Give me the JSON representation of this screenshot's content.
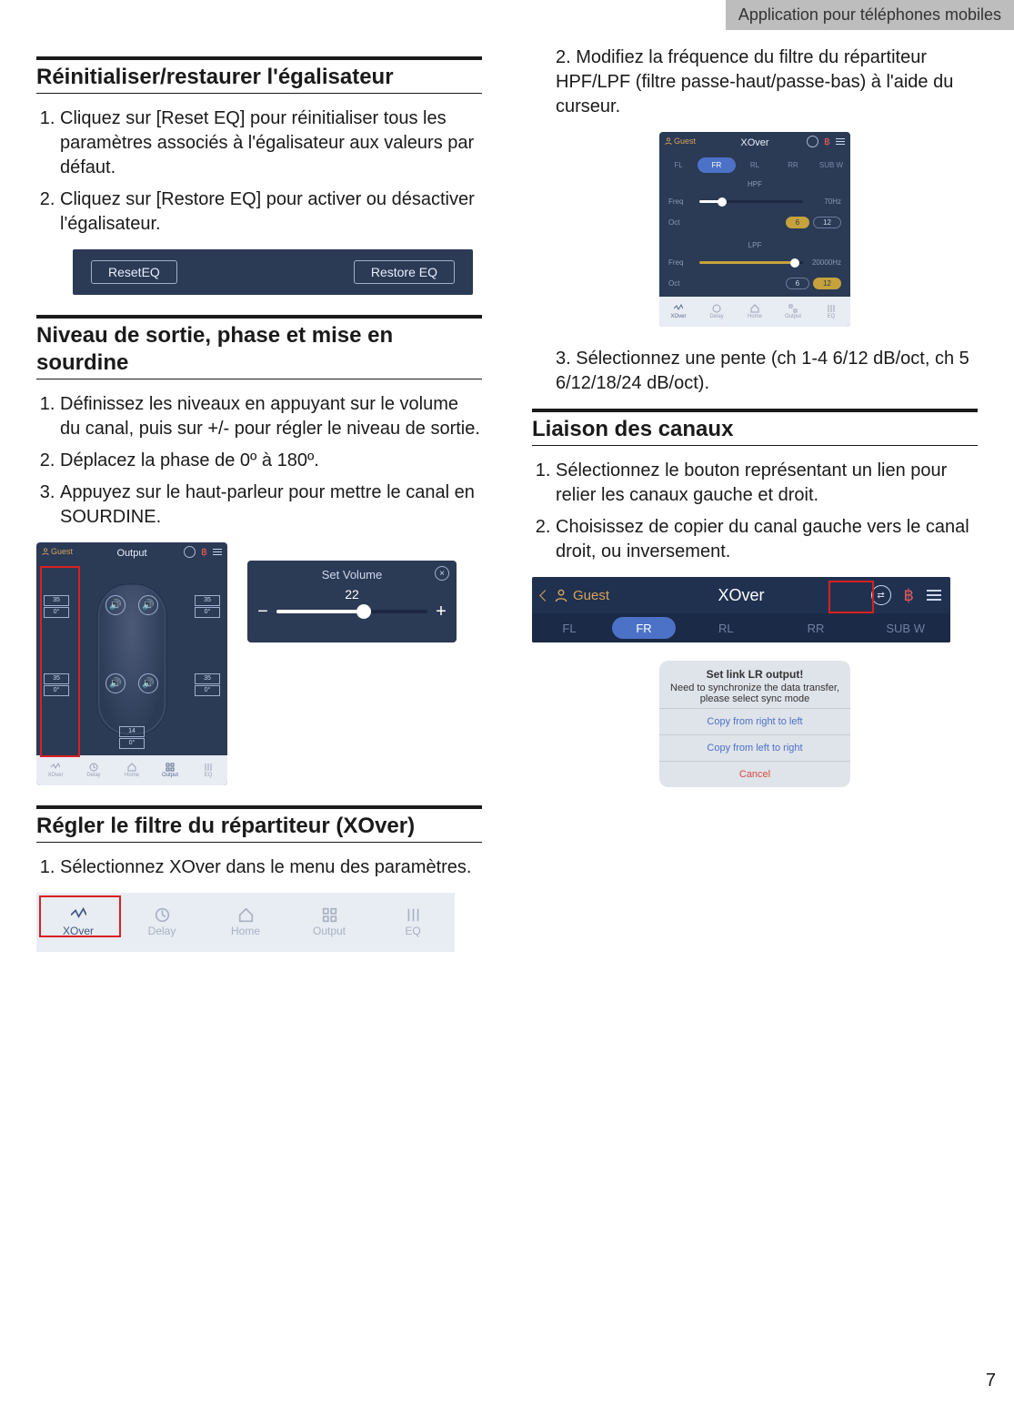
{
  "header_tab": "Application pour téléphones mobiles",
  "page_number": "7",
  "left": {
    "sec1_heading": "Réinitialiser/restaurer l'égalisateur",
    "sec1_li1": "Cliquez sur [Reset EQ] pour réinitialiser tous les paramètres associés à l'égalisateur aux valeurs par défaut.",
    "sec1_li2": "Cliquez sur [Restore EQ] pour activer ou désactiver l'égalisateur.",
    "eq_bar": {
      "reset": "ResetEQ",
      "restore": "Restore EQ"
    },
    "sec2_heading": "Niveau de sortie, phase et mise en sourdine",
    "sec2_li1": "Définissez les niveaux en appuyant sur le volume du canal, puis sur +/- pour régler le niveau de sortie.",
    "sec2_li2": "Déplacez la phase de 0º à 180º.",
    "sec2_li3": "Appuyez sur le haut-parleur pour mettre le canal en SOURDINE.",
    "output_screen": {
      "guest": "Guest",
      "title": "Output",
      "ch_val": "35",
      "ch_deg": "0°",
      "sub_val": "14",
      "sub_deg": "0°",
      "tabs": {
        "xover": "XOver",
        "delay": "Delay",
        "home": "Home",
        "output": "Output",
        "eq": "EQ"
      }
    },
    "setvol": {
      "title": "Set Volume",
      "value": "22"
    },
    "sec3_heading": "Régler le filtre du répartiteur (XOver)",
    "sec3_li1": "Sélectionnez XOver dans le menu des paramètres.",
    "menu_fig": {
      "xover": "XOver",
      "delay": "Delay",
      "home": "Home",
      "output": "Output",
      "eq": "EQ"
    }
  },
  "right": {
    "sec3_li2": "Modifiez la fréquence du filtre du répartiteur HPF/LPF (filtre passe-haut/passe-bas) à l'aide du curseur.",
    "xover_screen": {
      "guest": "Guest",
      "title": "XOver",
      "tabs": {
        "fl": "FL",
        "fr": "FR",
        "rl": "RL",
        "rr": "RR",
        "sub": "SUB W"
      },
      "hpf": "HPF",
      "lpf": "LPF",
      "freq_label": "Freq",
      "oct_label": "Oct",
      "hpf_freq": "70Hz",
      "lpf_freq": "20000Hz",
      "pill6": "6",
      "pill12": "12",
      "pill6b": "6",
      "pill12b": "12",
      "bottom_tabs": {
        "xover": "XOver",
        "delay": "Delay",
        "home": "Home",
        "output": "Output",
        "eq": "EQ"
      }
    },
    "sec3_li3": "Sélectionnez une pente (ch 1-4 6/12 dB/oct, ch 5 6/12/18/24 dB/oct).",
    "sec4_heading": "Liaison des canaux",
    "sec4_li1": "Sélectionnez le bouton représentant un lien pour relier les canaux gauche et droit.",
    "sec4_li2": "Choisissez de copier du canal gauche vers le canal droit, ou inversement.",
    "link_bar": {
      "guest": "Guest",
      "title": "XOver",
      "tabs": {
        "fl": "FL",
        "fr": "FR",
        "rl": "RL",
        "rr": "RR",
        "sub": "SUB W"
      }
    },
    "dialog": {
      "title": "Set link LR output!",
      "sub": "Need to synchronize the data transfer, please select sync mode",
      "opt1": "Copy from right to left",
      "opt2": "Copy from left to right",
      "cancel": "Cancel"
    }
  }
}
